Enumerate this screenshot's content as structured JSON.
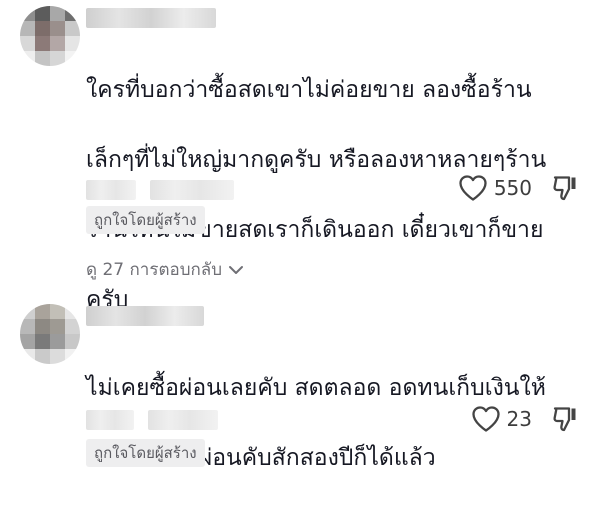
{
  "comments": [
    {
      "text_lines": [
        "ใครที่บอกว่าซื้อสดเขาไม่ค่อยขาย ลองซื้อร้าน",
        "เล็กๆที่ไม่ใหญ่มากดูครับ หรือลองหาหลายๆร้าน",
        "ร้านไหนไม่ขายสดเราก็เดินออก เดี๋ยวเขาก็ขาย",
        "ครับ"
      ],
      "like_count": "550",
      "creator_badge": "ถูกใจโดยผู้สร้าง",
      "replies_label": "ดู 27 การตอบกลับ",
      "icons": {
        "like": "heart-icon",
        "dislike": "thumbs-down-icon",
        "expand": "chevron-down-icon"
      }
    },
    {
      "text_lines": [
        "ไม่เคยซื้อผ่อนเลยคับ สดตลอด อดทนเก็บเงินให้",
        "เท่ากับที่เราผ่อนคับสักสองปีก็ได้แล้ว"
      ],
      "like_count": "23",
      "creator_badge": "ถูกใจโดยผู้สร้าง",
      "icons": {
        "like": "heart-icon",
        "dislike": "thumbs-down-icon"
      }
    }
  ]
}
